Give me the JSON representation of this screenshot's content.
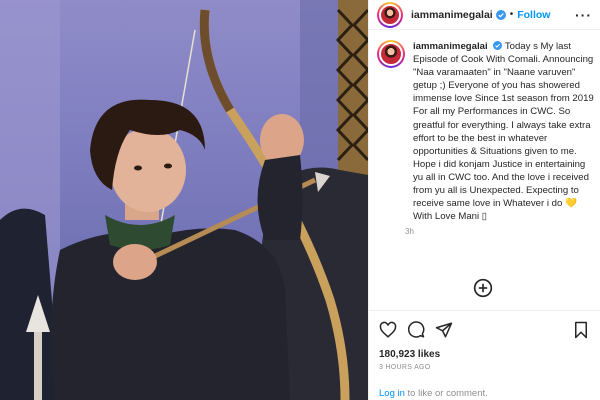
{
  "post": {
    "username": "iammanimegalai",
    "follow_label": "Follow",
    "more_icon": "more-horizontal-icon",
    "verified_icon": "verified-badge-icon"
  },
  "caption": {
    "username": "iammanimegalai",
    "text": "Today s My last Episode of Cook With Comali. Announcing \"Naa varamaaten\" in \"Naane varuven\" getup ;) Everyone of you has showered immense love Since 1st season from 2019 For all my Performances in CWC. So greatful for everything. I always take extra effort to be the best in whatever opportunities & Situations given to me. Hope i did konjam Justice in entertaining yu all in CWC too. And the love i received from yu all is Unexpected. Expecting to receive same love in Whatever i do",
    "heart": "💛",
    "signoff": "With Love Mani ▯",
    "time": "3h"
  },
  "actions": {
    "like_icon": "heart-icon",
    "comment_icon": "comment-icon",
    "share_icon": "share-icon",
    "save_icon": "bookmark-icon",
    "add_icon": "add-circle-icon"
  },
  "stats": {
    "likes": "180,923 likes",
    "posted": "3 HOURS AGO"
  },
  "footer": {
    "login_link": "Log in",
    "login_rest": " to like or comment."
  },
  "colors": {
    "link_blue": "#0095f6",
    "text": "#262626",
    "muted": "#8e8e8e"
  }
}
